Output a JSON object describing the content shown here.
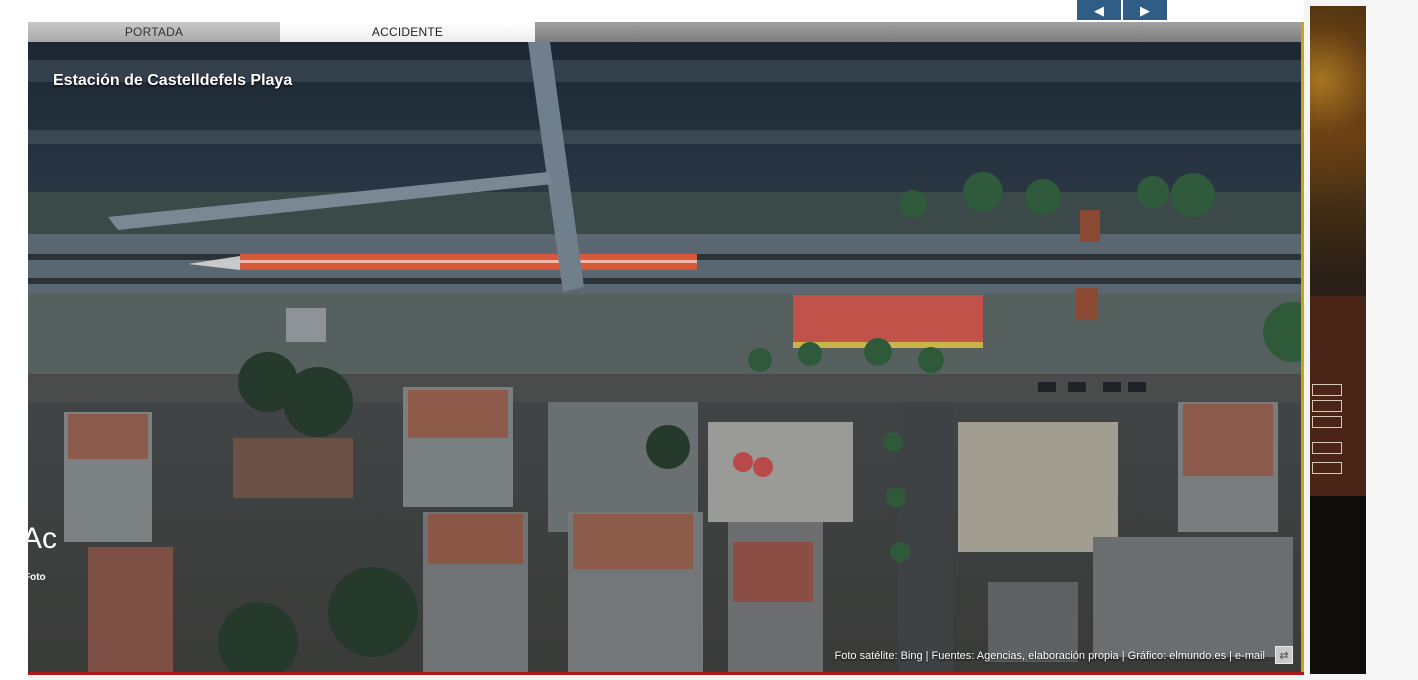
{
  "nav": {
    "prev_glyph": "◀",
    "next_glyph": "▶"
  },
  "tabs": [
    {
      "label": "PORTADA"
    },
    {
      "label": "ACCIDENTE"
    }
  ],
  "map": {
    "title": "Estación de Castelldefels Playa",
    "credits": "Foto satélite: Bing | Fuentes: Agencias, elaboración propia | Gráfico: elmundo.es | e-mail",
    "expand_glyph": "⇄"
  },
  "side_panel": {
    "headline": "Ac",
    "caption": "Foto"
  },
  "colors": {
    "tab_active": "#ffffff",
    "tab_inactive": "#b8b8b8",
    "accent_border": "#c8a418",
    "bottom_border": "#b0181c",
    "train": "#d8583b",
    "arrow_button": "#2f5d86"
  }
}
